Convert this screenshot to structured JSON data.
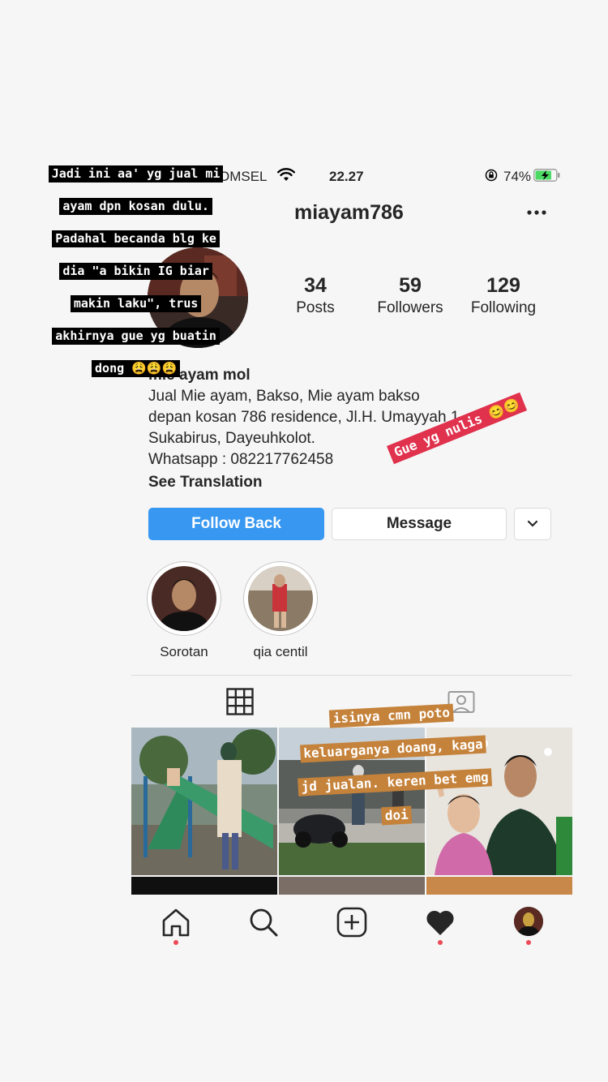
{
  "status_bar": {
    "carrier": "OMSEL",
    "time": "22.27",
    "battery": "74%",
    "icons": [
      "wifi-icon",
      "rotation-lock-icon",
      "battery-charging-icon"
    ]
  },
  "profile": {
    "username": "miayam786",
    "stats": [
      {
        "num": "34",
        "label": "Posts"
      },
      {
        "num": "59",
        "label": "Followers"
      },
      {
        "num": "129",
        "label": "Following"
      }
    ],
    "name": "mie ayam mol",
    "bio_lines": [
      "Jual Mie ayam, Bakso, Mie ayam bakso",
      "depan kosan 786 residence, Jl.H. Umayyah 1",
      "Sukabirus, Dayeuhkolot.",
      "Whatsapp : 082217762458"
    ],
    "see_translation": "See Translation"
  },
  "buttons": {
    "follow_back": "Follow Back",
    "message": "Message"
  },
  "highlights": [
    {
      "label": "Sorotan"
    },
    {
      "label": "qia centil"
    }
  ],
  "captions": {
    "top_left_lines": [
      "Jadi ini aa' yg jual mi",
      "ayam dpn kosan dulu.",
      "Padahal becanda blg ke",
      "dia \"a bikin IG biar",
      "makin laku\", trus",
      "akhirnya gue yg buatin",
      "dong 😩😩😩"
    ],
    "red_tag": "Gue yg nulis 😊😊",
    "orange_lines": [
      "isinya cmn poto",
      "keluarganya doang, kaga",
      "jd jualan. keren bet emg",
      "doi"
    ]
  },
  "colors": {
    "accent_blue": "#3897f0",
    "notification_red": "#ed4956",
    "caption_orange": "#c5823a",
    "caption_red": "#e0314d"
  }
}
